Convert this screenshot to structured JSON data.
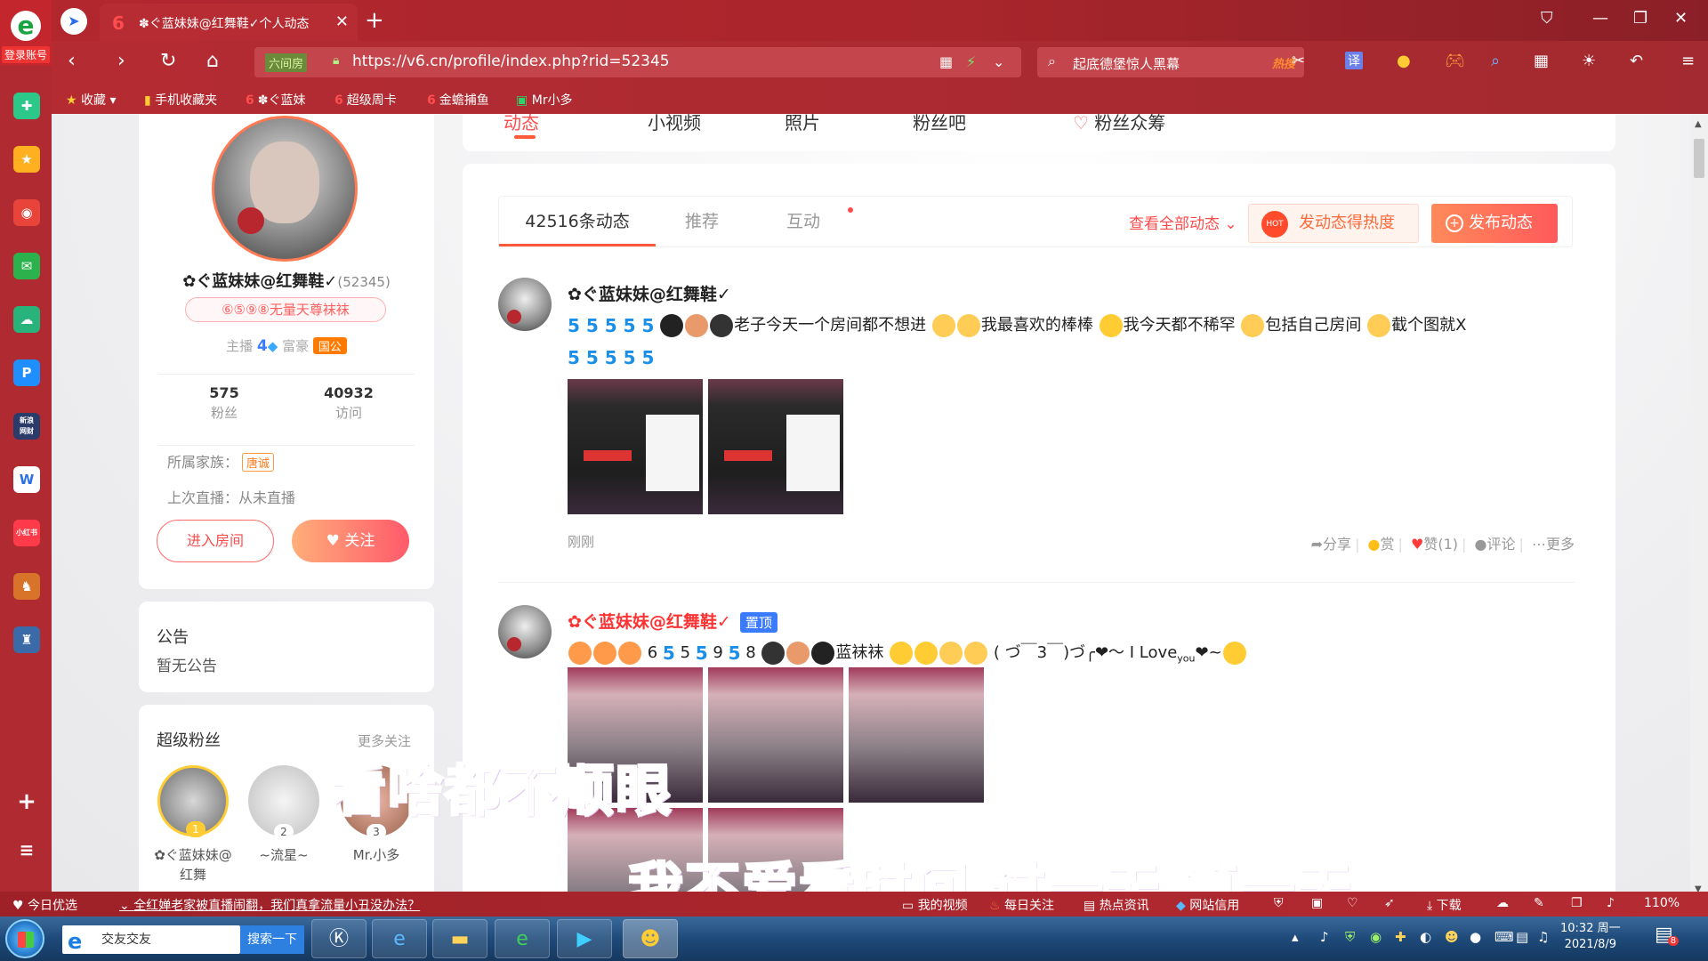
{
  "browser": {
    "logo_label": "登录账号",
    "tab_title": "✽ぐ蓝妹妹@红舞鞋✓个人动态",
    "url": "https://v6.cn/profile/index.php?rid=52345",
    "security_label": "六间房",
    "search_text": "起底德堡惊人黑幕",
    "search_hot": "热搜",
    "translate": "译"
  },
  "bookmarks": [
    {
      "label": "收藏"
    },
    {
      "label": "手机收藏夹"
    },
    {
      "label": "✽ぐ蓝妹"
    },
    {
      "label": "超级周卡"
    },
    {
      "label": "金蟾捕鱼"
    },
    {
      "label": "Mr小多"
    }
  ],
  "sidebar": {
    "icons": [
      "plus-circle-icon",
      "star-icon",
      "weibo-icon",
      "mail-icon",
      "cloud-icon",
      "p-icon",
      "finance-icon",
      "word-icon",
      "xiaohongshu-icon",
      "game-icon",
      "game2-icon"
    ],
    "finance_label": "新浪\n网财",
    "xhs_label": "小红书"
  },
  "profile": {
    "nickname": "✿ぐ蓝妹妹@红舞鞋✓",
    "rid": "(52345)",
    "title_badge": "⑥⑤⑨⑧无量天尊袜袜",
    "anchor_label": "主播",
    "anchor_level": "4",
    "rich_label": "富豪",
    "rich_badge": "国公",
    "fans_count": "575",
    "fans_label": "粉丝",
    "visit_count": "40932",
    "visit_label": "访问",
    "family_label": "所属家族：",
    "family_tag": "唐诚",
    "last_live": "上次直播：从未直播",
    "enter_room": "进入房间",
    "follow": "关注"
  },
  "notice": {
    "heading": "公告",
    "body": "暂无公告"
  },
  "super_fans": {
    "heading": "超级粉丝",
    "more": "更多关注",
    "fans": [
      {
        "rank": "1",
        "name": "✿ぐ蓝妹妹@红舞"
      },
      {
        "rank": "2",
        "name": "~流星~"
      },
      {
        "rank": "3",
        "name": "Mr.小多"
      }
    ]
  },
  "top_tabs": [
    "动态",
    "小视频",
    "照片",
    "粉丝吧",
    "粉丝众筹"
  ],
  "feed_tabs": {
    "count": "42516条动态",
    "recommend": "推荐",
    "interact": "互动",
    "view_all": "查看全部动态",
    "heat_btn": "发动态得热度",
    "post_btn": "发布动态",
    "hot": "HOT"
  },
  "posts": [
    {
      "name": "✿ぐ蓝妹妹@红舞鞋✓",
      "text1": "老子今天一个房间都不想进",
      "text2": "我最喜欢的棒棒",
      "text3": "我今天都不稀罕",
      "text4": "包括自己房间",
      "text5": "截个图就X",
      "time": "刚刚",
      "share": "分享",
      "reward": "赏",
      "like": "赞(1)",
      "comment": "评论",
      "more": "更多"
    },
    {
      "name": "✿ぐ蓝妹妹@红舞鞋✓",
      "pin": "置顶",
      "nums": [
        "6",
        "5",
        "9",
        "8"
      ],
      "text1": "蓝袜袜",
      "text2": "( づ￣3￣)づ╭❤～ I Love",
      "text3": "you",
      "text4": "❤~"
    }
  ],
  "subtitles": {
    "line1": "看啥都不顺眼",
    "line2": "我不爱看时间 过一天 算一天"
  },
  "statusbar": {
    "today": "今日优选",
    "news": "全红婵老家被直播闹翻，我们真拿流量小丑没办法？",
    "video": "我的视频",
    "daily": "每日关注",
    "hotnews": "热点资讯",
    "credit": "网站信用",
    "download": "下载",
    "zoom": "110%"
  },
  "taskbar": {
    "search_text": "交友交友",
    "search_btn": "搜索一下",
    "time": "10:32 周一",
    "date": "2021/8/9",
    "notif_count": "8"
  },
  "colors": {
    "brand_red": "#b3262e",
    "accent_orange": "#ff5a3a",
    "link_red": "#ff4b4b",
    "subtitle_purple": "#c04be8"
  }
}
